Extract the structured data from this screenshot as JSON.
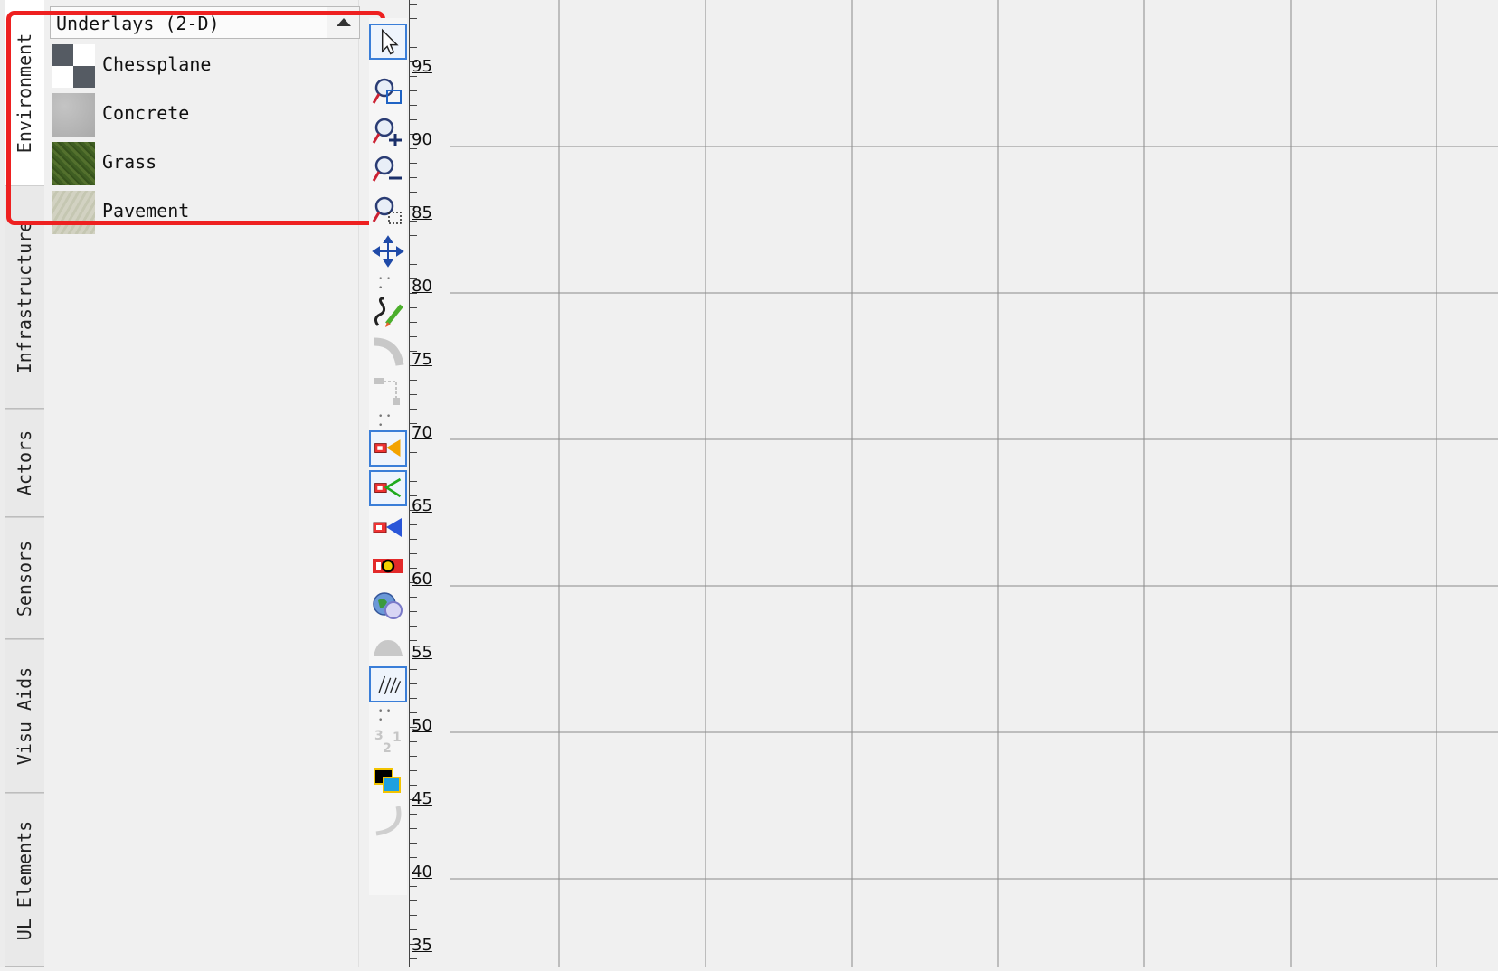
{
  "side_tabs": [
    {
      "label": "Environment",
      "active": true
    },
    {
      "label": "Infrastructure",
      "active": false
    },
    {
      "label": "Actors",
      "active": false
    },
    {
      "label": "Sensors",
      "active": false
    },
    {
      "label": "Visu Aids",
      "active": false
    },
    {
      "label": "UL Elements",
      "active": false
    }
  ],
  "library": {
    "category_title": "Underlays (2-D)",
    "items": [
      {
        "label": "Chessplane",
        "thumbnail": "chessplane-texture"
      },
      {
        "label": "Concrete",
        "thumbnail": "concrete-texture"
      },
      {
        "label": "Grass",
        "thumbnail": "grass-texture"
      },
      {
        "label": "Pavement",
        "thumbnail": "pavement-texture"
      }
    ]
  },
  "toolbar": {
    "tools": [
      {
        "name": "select-tool",
        "icon": "pointer-arrow-icon",
        "selected": true
      },
      {
        "name": "zoom-window-tool",
        "icon": "zoom-window-icon",
        "selected": false
      },
      {
        "name": "zoom-in-tool",
        "icon": "zoom-in-icon",
        "selected": false
      },
      {
        "name": "zoom-out-tool",
        "icon": "zoom-out-icon",
        "selected": false
      },
      {
        "name": "zoom-fit-tool",
        "icon": "zoom-fit-icon",
        "selected": false
      },
      {
        "name": "pan-tool",
        "icon": "move-arrows-icon",
        "selected": false
      },
      {
        "name": "draw-road-tool",
        "icon": "pencil-road-icon",
        "selected": false
      },
      {
        "name": "curve-road-tool",
        "icon": "curve-road-icon",
        "selected": false
      },
      {
        "name": "junction-tool",
        "icon": "junction-icon",
        "selected": false
      },
      {
        "name": "orange-sensor-tool",
        "icon": "orange-beam-sensor-icon",
        "selected": true
      },
      {
        "name": "green-sensor-tool",
        "icon": "green-beam-sensor-icon",
        "selected": true
      },
      {
        "name": "blue-sensor-tool",
        "icon": "blue-beam-sensor-icon",
        "selected": false
      },
      {
        "name": "radar-sensor-tool",
        "icon": "radar-sensor-icon",
        "selected": false
      },
      {
        "name": "globe-tool",
        "icon": "globe-icon",
        "selected": false
      },
      {
        "name": "terrain-tool",
        "icon": "terrain-icon",
        "selected": false
      },
      {
        "name": "trajectory-tool",
        "icon": "trajectory-icon",
        "selected": true
      },
      {
        "name": "ordering-tool",
        "icon": "numbers-321-icon",
        "selected": false
      },
      {
        "name": "layer-tool",
        "icon": "layers-icon",
        "selected": false
      },
      {
        "name": "arc-tool",
        "icon": "arc-icon",
        "selected": false
      }
    ]
  },
  "ruler": {
    "labels": [
      "95",
      "90",
      "85",
      "80",
      "75",
      "70",
      "65",
      "60",
      "55",
      "50",
      "45",
      "40",
      "35"
    ]
  },
  "grid": {
    "line_color": "#8a8a8a",
    "background": "#f0f0f0"
  }
}
